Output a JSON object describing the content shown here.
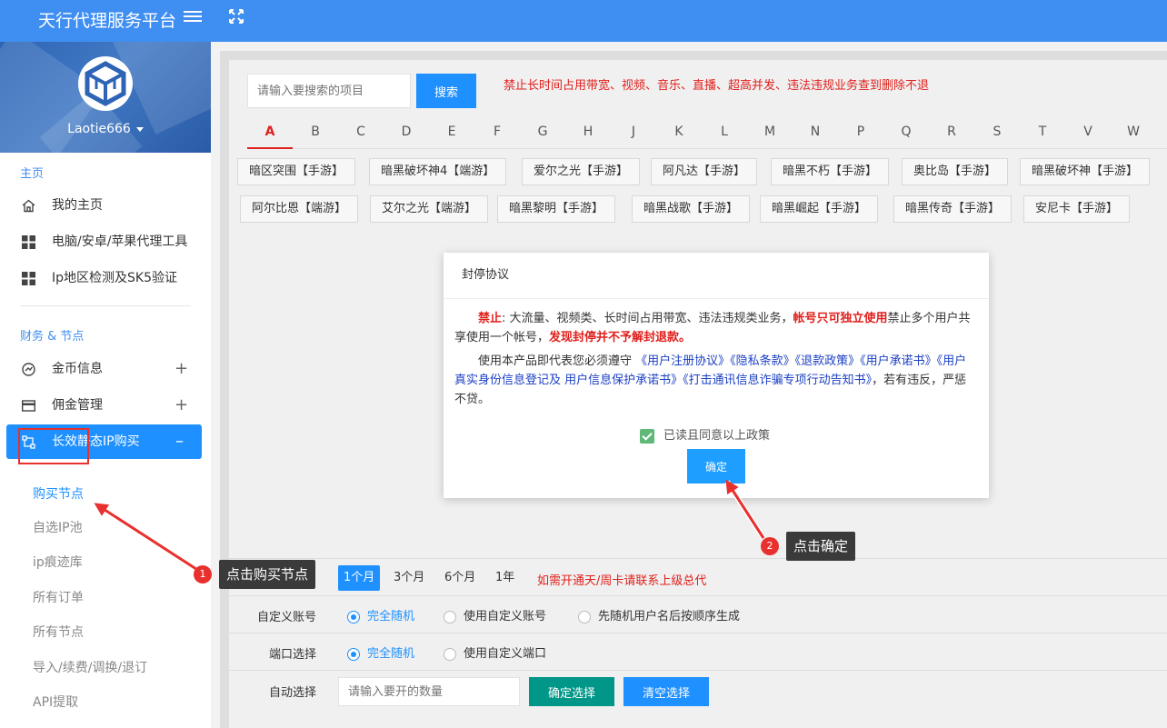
{
  "header": {
    "title": "天行代理服务平台"
  },
  "sidebar": {
    "username": "Laotie666",
    "sections": {
      "main": "主页",
      "finance": "财务 & 节点"
    },
    "items": {
      "home": "我的主页",
      "tools": "电脑/安卓/苹果代理工具",
      "ip_check": "Ip地区检测及SK5验证",
      "coins": "金币信息",
      "commission": "佣金管理",
      "static_ip": "长效静态IP购买"
    },
    "plus_sign": "+",
    "minus_sign": "–",
    "sub_items": [
      "购买节点",
      "自选IP池",
      "ip痕迹库",
      "所有订单",
      "所有节点",
      "导入/续费/调换/退订",
      "API提取"
    ]
  },
  "search": {
    "placeholder": "请输入要搜索的项目",
    "button": "搜索",
    "notice": "禁止长时间占用带宽、视频、音乐、直播、超高并发、违法违规业务查到删除不退"
  },
  "letters": [
    "A",
    "B",
    "C",
    "D",
    "E",
    "F",
    "G",
    "H",
    "J",
    "K",
    "L",
    "M",
    "N",
    "P",
    "Q",
    "R",
    "S",
    "T",
    "V",
    "W"
  ],
  "games_row1": [
    "暗区突围【手游】",
    "暗黑破坏神4【端游】",
    "爱尔之光【手游】",
    "阿凡达【手游】",
    "暗黑不朽【手游】",
    "奥比岛【手游】",
    "暗黑破坏神【手游】"
  ],
  "games_row2": [
    "阿尔比恩【端游】",
    "艾尔之光【端游】",
    "暗黑黎明【手游】",
    "暗黑战歌【手游】",
    "暗黑崛起【手游】",
    "暗黑传奇【手游】",
    "安尼卡【手游】"
  ],
  "form": {
    "periods": [
      "1个月",
      "3个月",
      "6个月",
      "1年"
    ],
    "period_note": "如需开通天/周卡请联系上级总代",
    "account_label": "自定义账号",
    "account_options": [
      "完全随机",
      "使用自定义账号",
      "先随机用户名后按顺序生成"
    ],
    "port_label": "端口选择",
    "port_options": [
      "完全随机",
      "使用自定义端口"
    ],
    "auto_label": "自动选择",
    "qty_placeholder": "请输入要开的数量",
    "confirm_select": "确定选择",
    "clear_select": "清空选择"
  },
  "modal": {
    "title": "封停协议",
    "p1_warn1": "禁止",
    "p1_text1": ": 大流量、视频类、长时间占用带宽、违法违规类业务，",
    "p1_warn2": "帐号只可独立使用",
    "p1_text2": "禁止多个用户共享使用一个帐号，",
    "p1_warn3": "发现封停并不予解封退款。",
    "p2_text1": "使用本产品即代表您必须遵守",
    "p2_links": " 《用户注册协议》《隐私条款》《退款政策》《用户承诺书》《用户真实身份信息登记及 用户信息保护承诺书》《打击通讯信息诈骗专项行动告知书》",
    "p2_text2": "，若有违反，严惩不贷。",
    "agree": "已读且同意以上政策",
    "ok": "确定"
  },
  "annotations": {
    "step1_num": "1",
    "step1_text": "点击购买节点",
    "step2_num": "2",
    "step2_text": "点击确定"
  },
  "colors": {
    "header": "#3f8ef2",
    "primary": "#1e90ff",
    "danger": "#e0201c",
    "teal": "#009688",
    "callout": "#3a3a3a"
  }
}
